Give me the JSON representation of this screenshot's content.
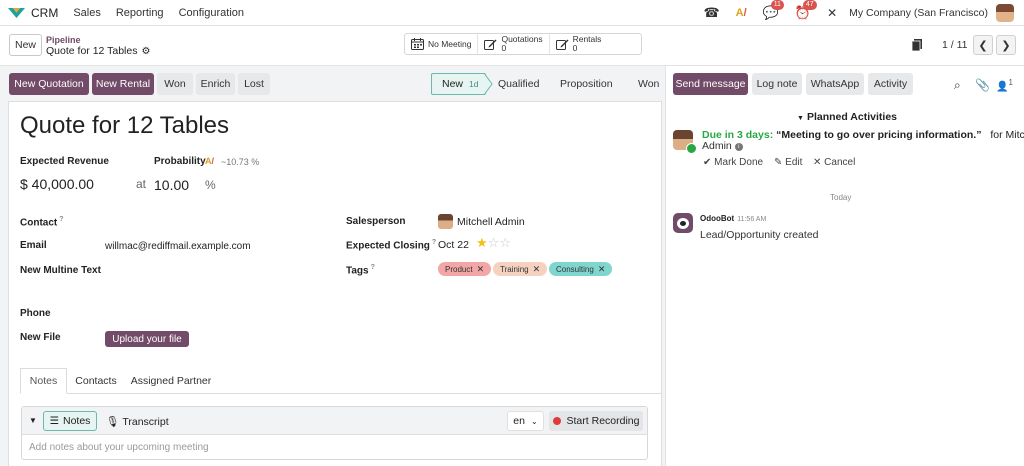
{
  "app": {
    "name": "CRM"
  },
  "menu": [
    {
      "label": "Sales"
    },
    {
      "label": "Reporting"
    },
    {
      "label": "Configuration"
    }
  ],
  "systray": {
    "messages_count": "11",
    "activities_count": "47",
    "company": "My Company (San Francisco)"
  },
  "control_panel": {
    "new_label": "New",
    "breadcrumb_parent": "Pipeline",
    "breadcrumb_current": "Quote for 12 Tables",
    "smart_buttons": {
      "meeting": "No Meeting",
      "quotations_label": "Quotations",
      "quotations_count": "0",
      "rentals_label": "Rentals",
      "rentals_count": "0"
    },
    "pager": "1 / 11"
  },
  "actions": {
    "new_quotation": "New Quotation",
    "new_rental": "New Rental",
    "won": "Won",
    "enrich": "Enrich",
    "lost": "Lost"
  },
  "stages": {
    "current": "New",
    "current_duration": "1d",
    "qualified": "Qualified",
    "proposition": "Proposition",
    "won": "Won"
  },
  "form": {
    "title": "Quote for 12 Tables",
    "expected_revenue_label": "Expected Revenue",
    "expected_revenue": "$ 40,000.00",
    "probability_label": "Probability",
    "probability_ai": "~10.73 %",
    "at": "at",
    "probability": "10.00",
    "percent": "%",
    "contact_label": "Contact",
    "email_label": "Email",
    "email": "willmac@rediffmail.example.com",
    "multiline_label": "New Multine Text",
    "phone_label": "Phone",
    "file_label": "New File",
    "upload_label": "Upload your file",
    "salesperson_label": "Salesperson",
    "salesperson": "Mitchell Admin",
    "closing_label": "Expected Closing",
    "closing": "Oct 22",
    "priority_stars": 1,
    "tags_label": "Tags",
    "tags": [
      {
        "label": "Product",
        "color": "#f3a6a6"
      },
      {
        "label": "Training",
        "color": "#f5d2c0"
      },
      {
        "label": "Consulting",
        "color": "#7fd6cf"
      }
    ]
  },
  "tabs": {
    "notes": "Notes",
    "contacts": "Contacts",
    "partner": "Assigned Partner"
  },
  "notes_editor": {
    "notes_btn": "Notes",
    "transcript": "Transcript",
    "lang": "en",
    "record": "Start Recording",
    "placeholder": "Add notes about your upcoming meeting"
  },
  "chatter": {
    "send_message": "Send message",
    "log_note": "Log note",
    "whatsapp": "WhatsApp",
    "activity": "Activity",
    "followers_count": "1",
    "planned_title": "Planned Activities",
    "activity_due": "Due in 3 days:",
    "activity_summary": "“Meeting to go over pricing information.”",
    "activity_for": "for Mitchell",
    "activity_user": "Admin",
    "mark_done": "Mark Done",
    "edit": "Edit",
    "cancel": "Cancel",
    "date_separator": "Today",
    "bot_name": "OdooBot",
    "bot_time": "11:56 AM",
    "bot_message": "Lead/Opportunity created"
  },
  "colors": {
    "brand": "#714b67",
    "success": "#28a745",
    "stage_active_bg": "#e6f4f2",
    "stage_active_border": "#6cb8ac",
    "badge": "#d9534f"
  }
}
